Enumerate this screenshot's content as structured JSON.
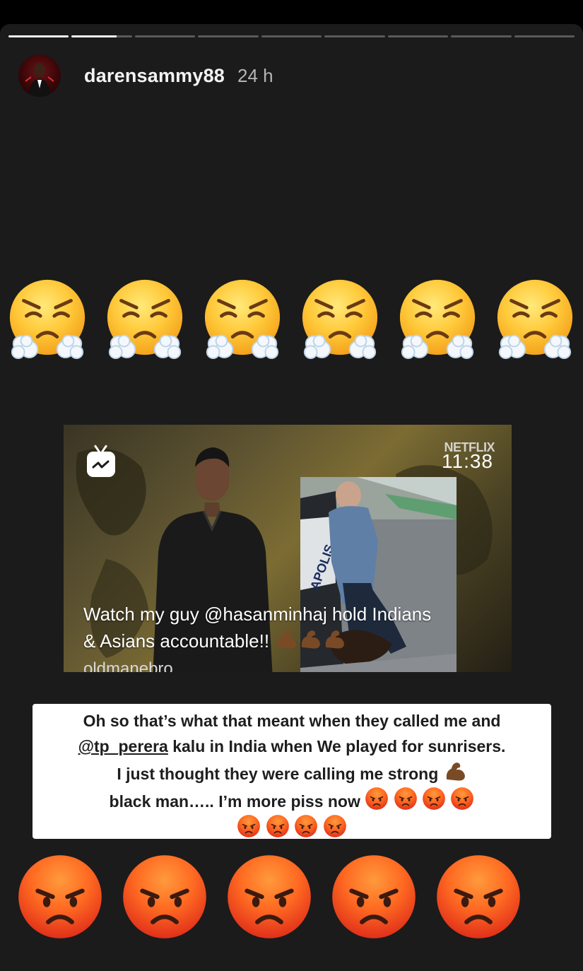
{
  "story": {
    "segments_total": 9,
    "segments_complete": 1,
    "current_segment_progress": 0.74,
    "username": "darensammy88",
    "time_ago": "24 h"
  },
  "emoji": {
    "top_row": [
      "steam-face",
      "steam-face",
      "steam-face",
      "steam-face",
      "steam-face",
      "steam-face"
    ],
    "bottom_row": [
      "angry-face",
      "angry-face",
      "angry-face",
      "angry-face",
      "angry-face"
    ]
  },
  "video_post": {
    "overlay_brand": "NETFLIX",
    "overlay_time": "11:38",
    "caption_line1": "Watch my guy @hasanminhaj hold Indians",
    "caption_line2": "& Asians accountable!!",
    "handle": "oldmanebro",
    "photo_text": "APOLIS"
  },
  "note": {
    "line1": "Oh so that’s what that meant when they called me and",
    "line2_mention": "@tp_perera",
    "line2_rest": " kalu in India when We played for sunrisers.",
    "line3": "I just thought they were calling me strong",
    "line4": "black man….. I’m more piss now"
  },
  "colors": {
    "story_bg": "#1b1b1b",
    "progress_fill": "#f2f2f2",
    "progress_track": "#5a5a5a",
    "note_bg": "#ffffff"
  }
}
